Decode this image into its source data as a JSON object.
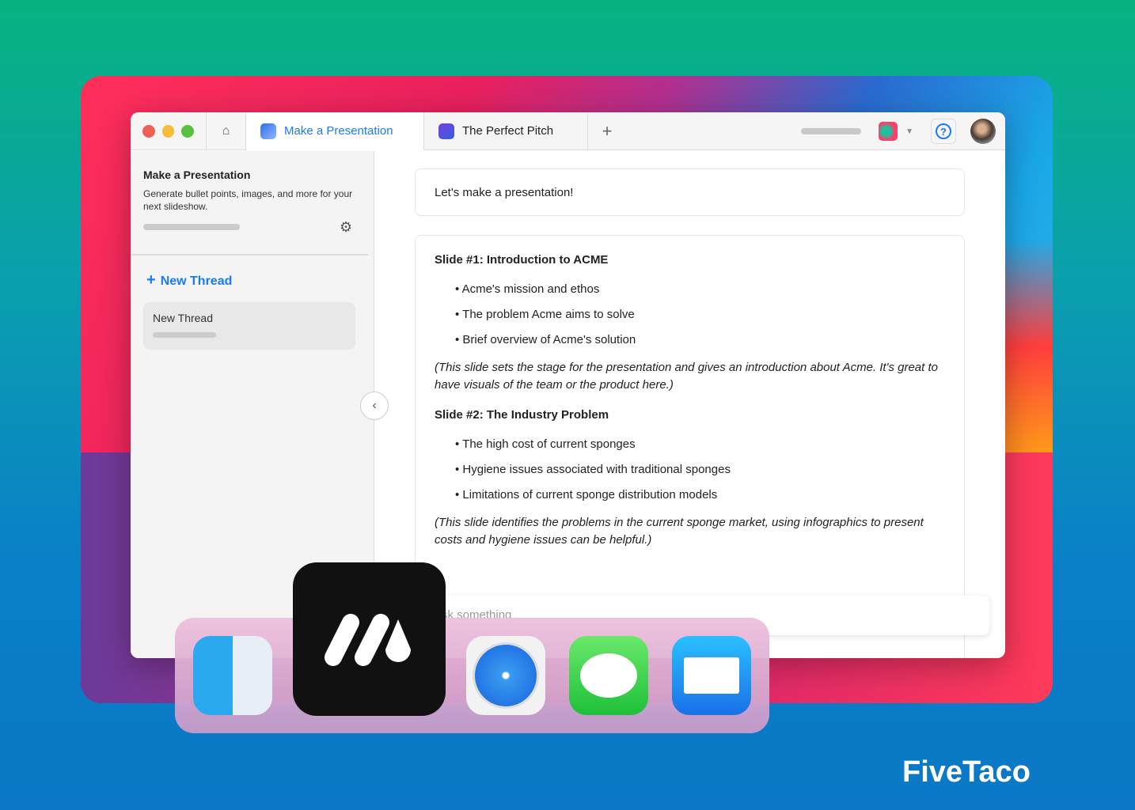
{
  "window": {
    "tabs": [
      {
        "label": "Make a Presentation",
        "active": true
      },
      {
        "label": "The Perfect Pitch",
        "active": false
      }
    ],
    "new_tab": "+",
    "help": "?"
  },
  "sidebar": {
    "title": "Make a Presentation",
    "description": "Generate bullet points, images, and more for your next slideshow.",
    "new_thread_label": "New Thread",
    "threads": [
      {
        "label": "New Thread"
      }
    ]
  },
  "chat": {
    "user_message": "Let's make a presentation!",
    "slides": [
      {
        "title": "Slide #1: Introduction to ACME",
        "bullets": [
          "Acme's mission and ethos",
          "The problem Acme aims to solve",
          "Brief overview of Acme's solution"
        ],
        "note": "(This slide sets the stage for the presentation and gives an introduction about Acme. It's great to have visuals of the team or the product here.)"
      },
      {
        "title": "Slide #2: The Industry Problem",
        "bullets": [
          "The high cost of current sponges",
          "Hygiene issues associated with traditional sponges",
          "Limitations of current sponge distribution models"
        ],
        "note": "(This slide identifies the problems in the current sponge market, using infographics to present costs and hygiene issues can be helpful.)"
      }
    ],
    "input_placeholder": "Ask something"
  },
  "dock": {
    "apps": [
      "Finder",
      "Safari",
      "Messages",
      "Mail"
    ]
  },
  "brand": "FiveTaco"
}
